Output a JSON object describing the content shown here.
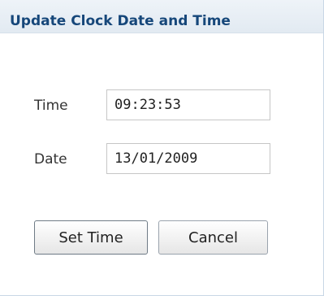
{
  "dialog": {
    "title": "Update Clock Date and Time"
  },
  "form": {
    "time_label": "Time",
    "time_value": "09:23:53",
    "date_label": "Date",
    "date_value": "13/01/2009"
  },
  "buttons": {
    "set_time": "Set Time",
    "cancel": "Cancel"
  }
}
